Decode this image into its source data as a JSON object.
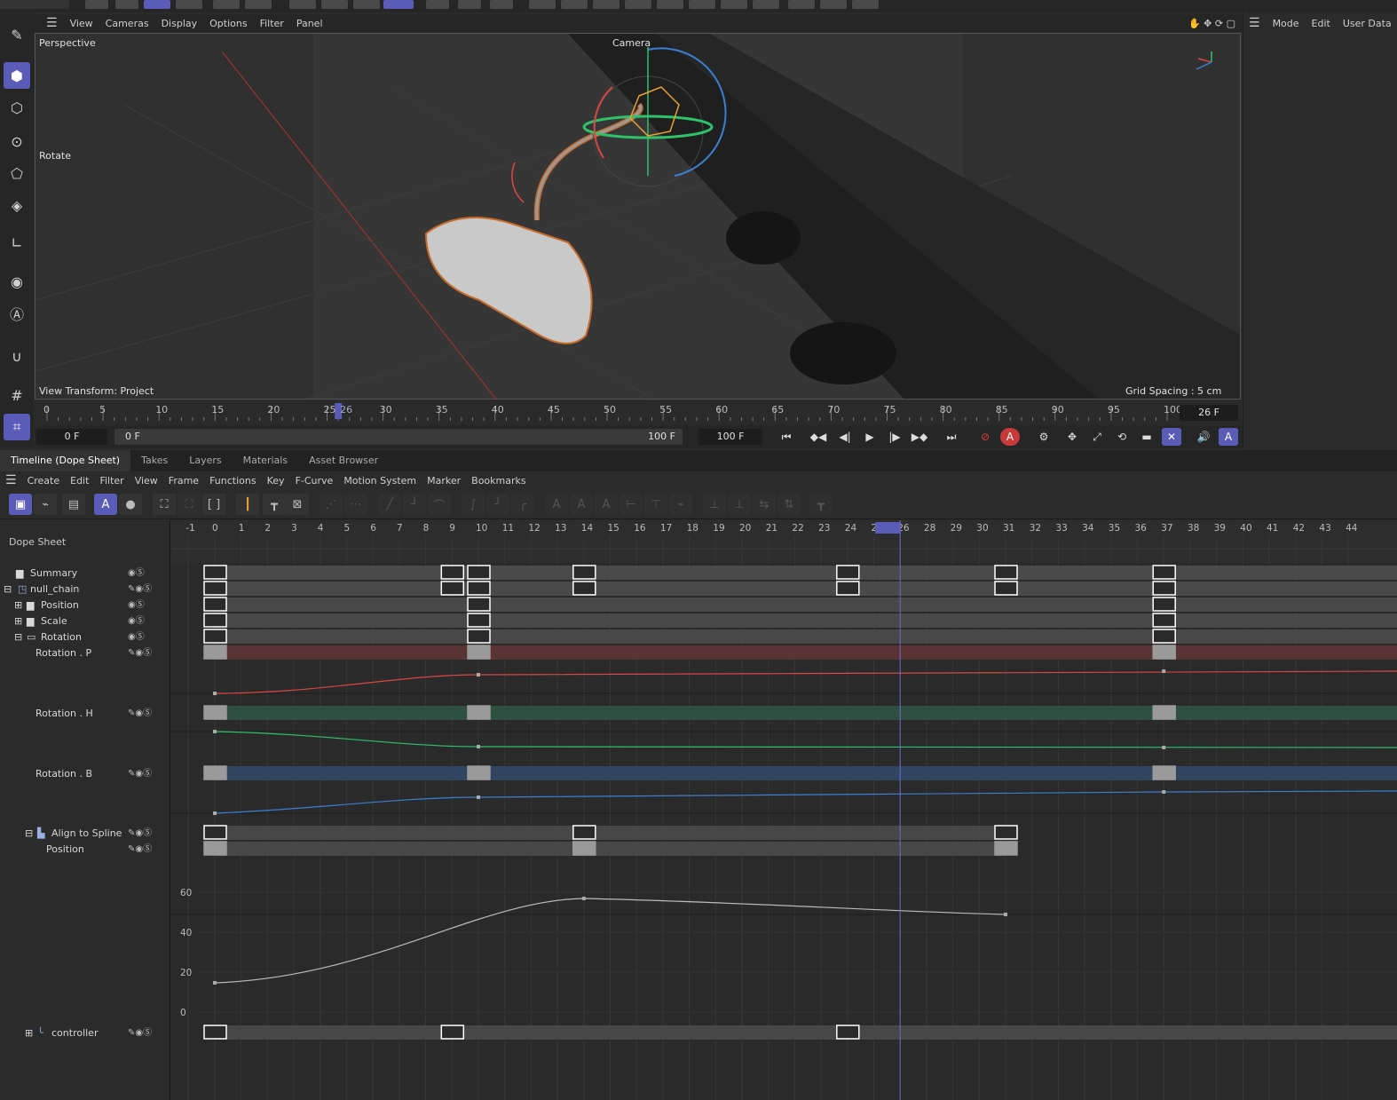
{
  "viewport_menu": [
    "View",
    "Cameras",
    "Display",
    "Options",
    "Filter",
    "Panel"
  ],
  "viewport": {
    "name": "Perspective",
    "camera_label": "Camera",
    "mode_label": "Rotate",
    "view_transform": "View Transform: Project",
    "grid_spacing": "Grid Spacing : 5 cm"
  },
  "attributes_menu": [
    "Mode",
    "Edit",
    "User Data"
  ],
  "ruler": {
    "ticks": [
      "0",
      "5",
      "10",
      "15",
      "20",
      "25",
      "26",
      "30",
      "35",
      "40",
      "45",
      "50",
      "55",
      "60",
      "65",
      "70",
      "75",
      "80",
      "85",
      "90",
      "95",
      "100"
    ],
    "current_frame": "26 F"
  },
  "transport": {
    "start_field": "0 F",
    "range_start": "0 F",
    "range_end": "100 F",
    "end_field": "100 F"
  },
  "tabs": [
    "Timeline (Dope Sheet)",
    "Takes",
    "Layers",
    "Materials",
    "Asset Browser"
  ],
  "timeline_menu": [
    "Create",
    "Edit",
    "Filter",
    "View",
    "Frame",
    "Functions",
    "Key",
    "F-Curve",
    "Motion System",
    "Marker",
    "Bookmarks"
  ],
  "tree": {
    "header": "Dope Sheet",
    "rows": [
      {
        "label": "Summary"
      },
      {
        "label": "null_chain"
      },
      {
        "label": "Position"
      },
      {
        "label": "Scale"
      },
      {
        "label": "Rotation"
      },
      {
        "label": "Rotation . P"
      },
      {
        "label": "Rotation . H"
      },
      {
        "label": "Rotation . B"
      },
      {
        "label": "Align to Spline"
      },
      {
        "label": "Position"
      },
      {
        "label": "controller"
      }
    ]
  },
  "sheet": {
    "frames": [
      "-1",
      "0",
      "1",
      "2",
      "3",
      "4",
      "5",
      "6",
      "7",
      "8",
      "9",
      "10",
      "11",
      "12",
      "13",
      "14",
      "15",
      "16",
      "17",
      "18",
      "19",
      "20",
      "21",
      "22",
      "23",
      "24",
      "25",
      "26",
      "28",
      "29",
      "30",
      "31",
      "32",
      "33",
      "34",
      "35",
      "36",
      "37",
      "38",
      "39",
      "40",
      "41",
      "42",
      "43",
      "44"
    ],
    "current_frame": 26,
    "fcurve_axis": [
      "60",
      "40",
      "20",
      "0"
    ]
  },
  "colors": {
    "accent": "#5b5bb8",
    "rotation_p": "#d9473f",
    "rotation_h": "#2ec26a",
    "rotation_b": "#3b7fd1"
  }
}
